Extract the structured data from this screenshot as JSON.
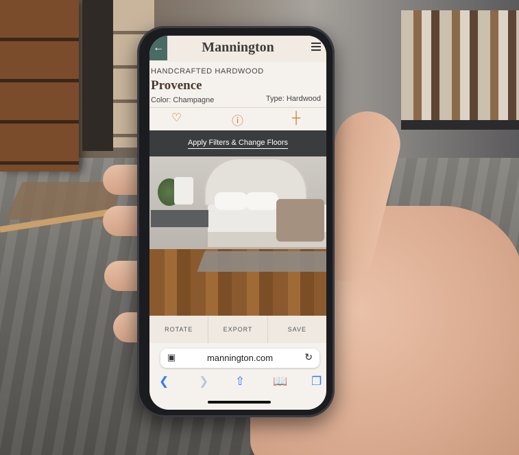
{
  "app": {
    "brand": "Mannington",
    "kicker": "HANDCRAFTED HARDWOOD",
    "product_name": "Provence",
    "color_label": "Color: Champagne",
    "type_label": "Type: Hardwood",
    "filters_label": "Apply Filters & Change Floors",
    "actions": [
      "ROTATE",
      "EXPORT",
      "SAVE"
    ],
    "icons": {
      "back": "arrow-left-icon",
      "menu": "hamburger-menu-icon",
      "favorite": "heart-icon",
      "info": "info-icon",
      "sample": "chair-icon"
    },
    "accent_color": "#c57a35",
    "header_dark": "#3b3c3e"
  },
  "browser": {
    "url": "mannington.com",
    "icons": [
      "tab-icon",
      "reload-icon",
      "back-chevron-icon",
      "forward-chevron-icon",
      "share-icon",
      "bookmarks-icon",
      "tabs-icon"
    ]
  }
}
